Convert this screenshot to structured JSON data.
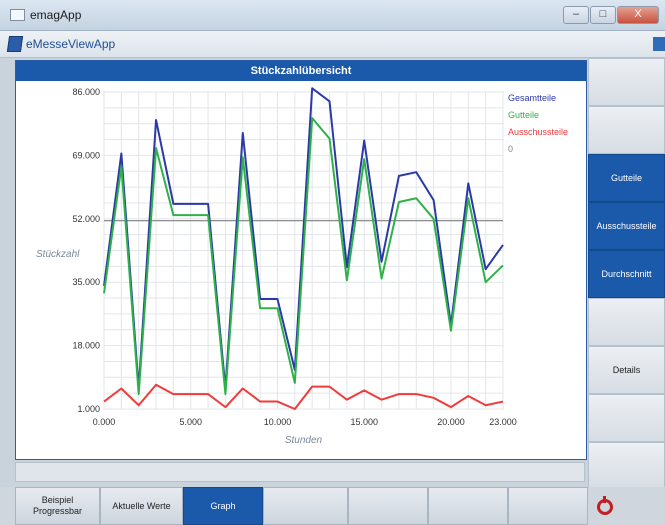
{
  "window": {
    "title": "emagApp",
    "close_glyph": "X",
    "min_glyph": "–",
    "max_glyph": "□"
  },
  "app": {
    "name": "eMesseViewApp"
  },
  "panel": {
    "title": "Stückzahlübersicht"
  },
  "sidebar": {
    "buttons": [
      "",
      "",
      "Gutteile",
      "Ausschussteile",
      "Durchschnitt",
      "",
      "Details",
      "",
      ""
    ],
    "active": [
      2,
      3,
      4
    ]
  },
  "bottom_tabs": [
    {
      "label": "Beispiel\nProgressbar"
    },
    {
      "label": "Aktuelle Werte"
    },
    {
      "label": "Graph",
      "active": true
    },
    {
      "label": ""
    },
    {
      "label": ""
    },
    {
      "label": ""
    },
    {
      "label": ""
    }
  ],
  "colors": {
    "accent": "#1b5aaa",
    "gesamt": "#2b3aa6",
    "gut": "#2fb14a",
    "ausschuss": "#ef3b3b"
  },
  "chart_data": {
    "type": "line",
    "xlabel": "Stunden",
    "ylabel": "Stückzahl",
    "xlim": [
      0,
      23000
    ],
    "ylim": [
      1000,
      86000
    ],
    "x_ticks": [
      "0.000",
      "5.000",
      "10.000",
      "15.000",
      "20.000",
      "23.000"
    ],
    "y_ticks": [
      "1.000",
      "18.000",
      "35.000",
      "52.000",
      "69.000",
      "86.000"
    ],
    "x_tick_values": [
      0,
      5000,
      10000,
      15000,
      20000,
      23000
    ],
    "y_tick_values": [
      1000,
      18000,
      35000,
      52000,
      69000,
      86000
    ],
    "reference_line": 51500,
    "legend": [
      "Gesamtteile",
      "Gutteile",
      "Ausschussteile",
      "0"
    ],
    "legend_position": "top-right",
    "x": [
      0,
      1000,
      2000,
      3000,
      4000,
      5000,
      6000,
      7000,
      8000,
      9000,
      10000,
      11000,
      12000,
      13000,
      14000,
      15000,
      16000,
      17000,
      18000,
      19000,
      20000,
      21000,
      22000,
      23000
    ],
    "series": [
      {
        "name": "Gesamtteile",
        "values": [
          34000,
          69500,
          6500,
          78500,
          56000,
          56000,
          56000,
          6500,
          75000,
          30500,
          30500,
          11500,
          87000,
          83500,
          39000,
          73000,
          40500,
          63500,
          64500,
          57000,
          23500,
          61500,
          38500,
          45000
        ]
      },
      {
        "name": "Gutteile",
        "values": [
          32000,
          66000,
          5000,
          71000,
          53000,
          53000,
          53000,
          5000,
          68500,
          28000,
          28000,
          8000,
          79000,
          73500,
          35500,
          68000,
          36000,
          56500,
          57500,
          52000,
          22000,
          57500,
          35000,
          39500
        ]
      },
      {
        "name": "Ausschussteile",
        "values": [
          3000,
          6500,
          2000,
          7500,
          5000,
          5000,
          5000,
          1500,
          6500,
          3000,
          3000,
          1000,
          7000,
          7000,
          3500,
          6000,
          3500,
          5000,
          5000,
          4000,
          1500,
          4500,
          2000,
          3000
        ]
      }
    ]
  }
}
